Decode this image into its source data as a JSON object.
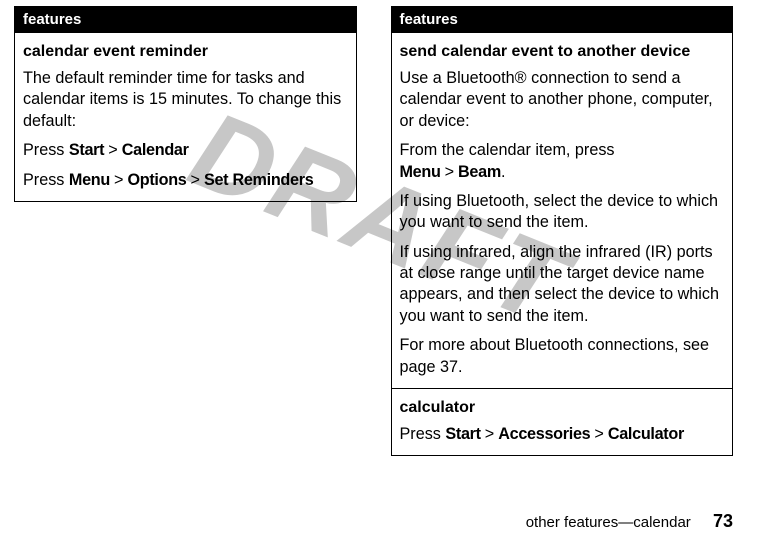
{
  "watermark": "DRAFT",
  "left": {
    "header": "features",
    "row1": {
      "title": "calendar event reminder",
      "para1": "The default reminder time for tasks and calendar items is 15 minutes. To change this default:",
      "line2_prefix": "Press ",
      "line2_k1": "Start",
      "gt": ">",
      "line2_k2": "Calendar",
      "line3_prefix": "Press ",
      "line3_k1": "Menu",
      "line3_k2": "Options",
      "line3_k3": "Set Reminders"
    }
  },
  "right": {
    "header": "features",
    "row1": {
      "title": "send calendar event to another device",
      "para1": "Use a Bluetooth® connection to send a calendar event to another phone, computer, or device:",
      "para2_prefix": "From the calendar item, press ",
      "para2_k1": "Menu",
      "gt": ">",
      "para2_k2": "Beam",
      "para2_suffix": ".",
      "para3": "If using Bluetooth, select the device to which you want to send the item.",
      "para4": "If using infrared, align the infrared (IR) ports at close range until the target device name appears, and then select the device to which you want to send the item.",
      "para5": "For more about Bluetooth connections, see page 37."
    },
    "row2": {
      "title": "calculator",
      "line_prefix": "Press ",
      "k1": "Start",
      "gt": ">",
      "k2": "Accessories",
      "k3": "Calculator"
    }
  },
  "footer": {
    "section": "other features—calendar",
    "page": "73"
  }
}
